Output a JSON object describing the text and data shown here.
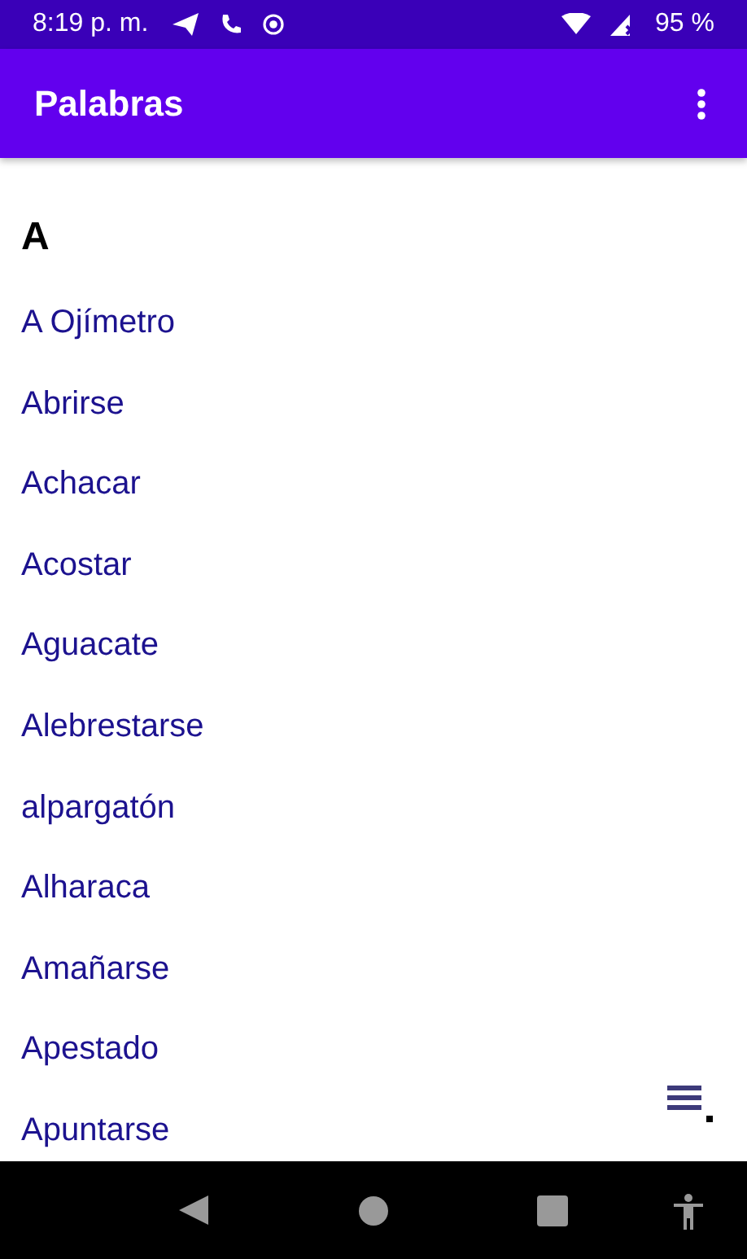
{
  "status_bar": {
    "time": "8:19 p. m.",
    "battery": "95 %"
  },
  "app_bar": {
    "title": "Palabras"
  },
  "section": {
    "header": "A",
    "words": [
      "A Ojímetro",
      "Abrirse",
      "Achacar",
      "Acostar",
      "Aguacate",
      "Alebrestarse",
      "alpargatón",
      "Alharaca",
      "Amañarse",
      "Apestado",
      "Apuntarse"
    ]
  }
}
